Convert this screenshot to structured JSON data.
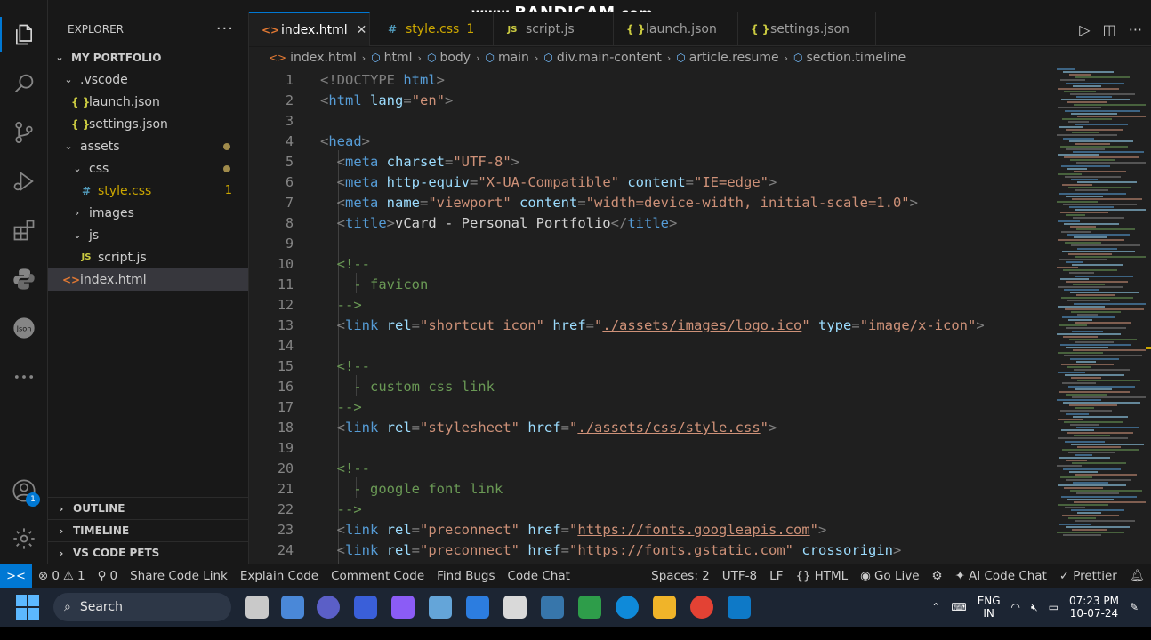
{
  "watermark": {
    "prefix": "www.",
    "brand": "BANDICAM",
    "suffix": ".com"
  },
  "explorer": {
    "title": "EXPLORER",
    "more": "···",
    "root": "MY PORTFOLIO",
    "tree": [
      {
        "label": ".vscode",
        "type": "folder",
        "depth": 1,
        "open": true
      },
      {
        "label": "launch.json",
        "type": "json",
        "depth": 2
      },
      {
        "label": "settings.json",
        "type": "json",
        "depth": 2
      },
      {
        "label": "assets",
        "type": "folder",
        "depth": 1,
        "open": true,
        "modified": true
      },
      {
        "label": "css",
        "type": "folder",
        "depth": 2,
        "open": true,
        "modified": true
      },
      {
        "label": "style.css",
        "type": "css",
        "depth": 3,
        "count": "1"
      },
      {
        "label": "images",
        "type": "folder",
        "depth": 2,
        "open": false
      },
      {
        "label": "js",
        "type": "folder",
        "depth": 2,
        "open": true
      },
      {
        "label": "script.js",
        "type": "js",
        "depth": 3
      },
      {
        "label": "index.html",
        "type": "html",
        "depth": 1,
        "selected": true
      }
    ],
    "outline": "OUTLINE",
    "timeline": "TIMELINE",
    "pets": "VS CODE PETS"
  },
  "tabs": [
    {
      "label": "index.html",
      "icon": "html",
      "active": true,
      "close": "✕"
    },
    {
      "label": "style.css",
      "icon": "css",
      "warn": "1"
    },
    {
      "label": "script.js",
      "icon": "js"
    },
    {
      "label": "launch.json",
      "icon": "json"
    },
    {
      "label": "settings.json",
      "icon": "json"
    }
  ],
  "breadcrumb": [
    "index.html",
    "html",
    "body",
    "main",
    "div.main-content",
    "article.resume",
    "section.timeline"
  ],
  "code": [
    {
      "n": "1",
      "tokens": [
        [
          "t",
          "<!DOCTYPE "
        ],
        [
          "tag",
          "html"
        ],
        [
          "t",
          ">"
        ]
      ]
    },
    {
      "n": "2",
      "tokens": [
        [
          "t",
          "<"
        ],
        [
          "tag",
          "html"
        ],
        [
          "t",
          " "
        ],
        [
          "attr",
          "lang"
        ],
        [
          "t",
          "="
        ],
        [
          "str",
          "\"en\""
        ],
        [
          "t",
          ">"
        ]
      ]
    },
    {
      "n": "3",
      "tokens": []
    },
    {
      "n": "4",
      "tokens": [
        [
          "t",
          "<"
        ],
        [
          "tag",
          "head"
        ],
        [
          "t",
          ">"
        ]
      ]
    },
    {
      "n": "5",
      "tokens": [
        [
          "t",
          "  <"
        ],
        [
          "tag",
          "meta"
        ],
        [
          "t",
          " "
        ],
        [
          "attr",
          "charset"
        ],
        [
          "t",
          "="
        ],
        [
          "str",
          "\"UTF-8\""
        ],
        [
          "t",
          ">"
        ]
      ]
    },
    {
      "n": "6",
      "tokens": [
        [
          "t",
          "  <"
        ],
        [
          "tag",
          "meta"
        ],
        [
          "t",
          " "
        ],
        [
          "attr",
          "http-equiv"
        ],
        [
          "t",
          "="
        ],
        [
          "str",
          "\"X-UA-Compatible\""
        ],
        [
          "t",
          " "
        ],
        [
          "attr",
          "content"
        ],
        [
          "t",
          "="
        ],
        [
          "str",
          "\"IE=edge\""
        ],
        [
          "t",
          ">"
        ]
      ]
    },
    {
      "n": "7",
      "tokens": [
        [
          "t",
          "  <"
        ],
        [
          "tag",
          "meta"
        ],
        [
          "t",
          " "
        ],
        [
          "attr",
          "name"
        ],
        [
          "t",
          "="
        ],
        [
          "str",
          "\"viewport\""
        ],
        [
          "t",
          " "
        ],
        [
          "attr",
          "content"
        ],
        [
          "t",
          "="
        ],
        [
          "str",
          "\"width=device-width, initial-scale=1.0\""
        ],
        [
          "t",
          ">"
        ]
      ]
    },
    {
      "n": "8",
      "tokens": [
        [
          "t",
          "  <"
        ],
        [
          "tag",
          "title"
        ],
        [
          "t",
          ">"
        ],
        [
          "txt",
          "vCard - Personal Portfolio"
        ],
        [
          "t",
          "</"
        ],
        [
          "tag",
          "title"
        ],
        [
          "t",
          ">"
        ]
      ]
    },
    {
      "n": "9",
      "tokens": []
    },
    {
      "n": "10",
      "tokens": [
        [
          "cmt",
          "  <!--"
        ]
      ]
    },
    {
      "n": "11",
      "tokens": [
        [
          "cmt",
          "    - favicon"
        ]
      ]
    },
    {
      "n": "12",
      "tokens": [
        [
          "cmt",
          "  -->"
        ]
      ]
    },
    {
      "n": "13",
      "tokens": [
        [
          "t",
          "  <"
        ],
        [
          "tag",
          "link"
        ],
        [
          "t",
          " "
        ],
        [
          "attr",
          "rel"
        ],
        [
          "t",
          "="
        ],
        [
          "str",
          "\"shortcut icon\""
        ],
        [
          "t",
          " "
        ],
        [
          "attr",
          "href"
        ],
        [
          "t",
          "="
        ],
        [
          "str",
          "\""
        ],
        [
          "link",
          "./assets/images/logo.ico"
        ],
        [
          "str",
          "\""
        ],
        [
          "t",
          " "
        ],
        [
          "attr",
          "type"
        ],
        [
          "t",
          "="
        ],
        [
          "str",
          "\"image/x-icon\""
        ],
        [
          "t",
          ">"
        ]
      ]
    },
    {
      "n": "14",
      "tokens": []
    },
    {
      "n": "15",
      "tokens": [
        [
          "cmt",
          "  <!--"
        ]
      ]
    },
    {
      "n": "16",
      "tokens": [
        [
          "cmt",
          "    - custom css link"
        ]
      ]
    },
    {
      "n": "17",
      "tokens": [
        [
          "cmt",
          "  -->"
        ]
      ]
    },
    {
      "n": "18",
      "tokens": [
        [
          "t",
          "  <"
        ],
        [
          "tag",
          "link"
        ],
        [
          "t",
          " "
        ],
        [
          "attr",
          "rel"
        ],
        [
          "t",
          "="
        ],
        [
          "str",
          "\"stylesheet\""
        ],
        [
          "t",
          " "
        ],
        [
          "attr",
          "href"
        ],
        [
          "t",
          "="
        ],
        [
          "str",
          "\""
        ],
        [
          "link",
          "./assets/css/style.css"
        ],
        [
          "str",
          "\""
        ],
        [
          "t",
          ">"
        ]
      ]
    },
    {
      "n": "19",
      "tokens": []
    },
    {
      "n": "20",
      "tokens": [
        [
          "cmt",
          "  <!--"
        ]
      ]
    },
    {
      "n": "21",
      "tokens": [
        [
          "cmt",
          "    - google font link"
        ]
      ]
    },
    {
      "n": "22",
      "tokens": [
        [
          "cmt",
          "  -->"
        ]
      ]
    },
    {
      "n": "23",
      "tokens": [
        [
          "t",
          "  <"
        ],
        [
          "tag",
          "link"
        ],
        [
          "t",
          " "
        ],
        [
          "attr",
          "rel"
        ],
        [
          "t",
          "="
        ],
        [
          "str",
          "\"preconnect\""
        ],
        [
          "t",
          " "
        ],
        [
          "attr",
          "href"
        ],
        [
          "t",
          "="
        ],
        [
          "str",
          "\""
        ],
        [
          "link",
          "https://fonts.googleapis.com"
        ],
        [
          "str",
          "\""
        ],
        [
          "t",
          ">"
        ]
      ]
    },
    {
      "n": "24",
      "tokens": [
        [
          "t",
          "  <"
        ],
        [
          "tag",
          "link"
        ],
        [
          "t",
          " "
        ],
        [
          "attr",
          "rel"
        ],
        [
          "t",
          "="
        ],
        [
          "str",
          "\"preconnect\""
        ],
        [
          "t",
          " "
        ],
        [
          "attr",
          "href"
        ],
        [
          "t",
          "="
        ],
        [
          "str",
          "\""
        ],
        [
          "link",
          "https://fonts.gstatic.com"
        ],
        [
          "str",
          "\""
        ],
        [
          "t",
          " "
        ],
        [
          "attr",
          "crossorigin"
        ],
        [
          "t",
          ">"
        ]
      ]
    }
  ],
  "status": {
    "remote": "><",
    "errors": "0",
    "warnings": "1",
    "ports": "0",
    "share": "Share Code Link",
    "explain": "Explain Code",
    "comment": "Comment Code",
    "bugs": "Find Bugs",
    "chat": "Code Chat",
    "spaces": "Spaces: 2",
    "encoding": "UTF-8",
    "eol": "LF",
    "language": "HTML",
    "golive": "Go Live",
    "aichat": "AI Code Chat",
    "prettier": "Prettier"
  },
  "taskbar": {
    "search": "Search",
    "lang_top": "ENG",
    "lang_bottom": "IN",
    "time": "07:23 PM",
    "date": "10-07-24",
    "notif_badge": "1"
  },
  "activity_badge": "1",
  "colors": {
    "accent": "#0078d4",
    "warning": "#cca700"
  }
}
